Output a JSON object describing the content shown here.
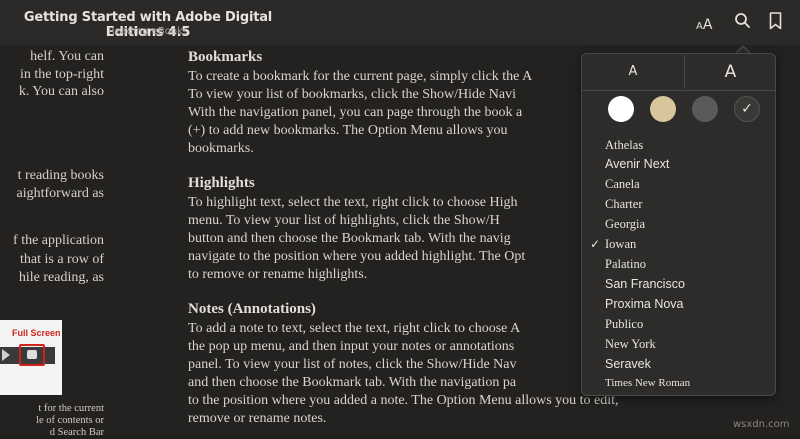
{
  "window": {
    "title": "Getting Started with Adobe Digital Editions 4.5",
    "subtitle": "Reading eBooks"
  },
  "toolbar": {
    "text_size_icon": "text-size-icon",
    "search_icon": "search-icon",
    "bookmark_icon": "bookmark-icon"
  },
  "left_column": {
    "lines": [
      "helf. You can",
      "in the top-right",
      "k. You can also",
      "t reading books",
      "aightforward as",
      "f the application",
      "that is a row of",
      "hile reading, as"
    ],
    "image_label": "Full Screen",
    "caption": [
      "t for the current",
      "le of contents or",
      "d  Search  Bar"
    ]
  },
  "content": {
    "sections": [
      {
        "heading": "Bookmarks",
        "lines": [
          "To create a bookmark for the current page, simply click the A",
          "To view your list of bookmarks, click the Show/Hide Navi",
          "With the navigation panel, you can page through the book a",
          "(+) to add new bookmarks. The Option Menu allows you",
          "bookmarks."
        ]
      },
      {
        "heading": "Highlights",
        "lines": [
          "To highlight text, select the text, right click to choose High",
          "menu. To view your list of highlights, click the Show/H",
          "button and then choose the Bookmark tab. With the navig",
          "navigate to the position where you added highlight. The Opt",
          "to remove or rename highlights."
        ]
      },
      {
        "heading": "Notes (Annotations)",
        "lines": [
          "To add a note to text, select the text, right click to choose A",
          "the pop up menu, and then input your notes or annotations",
          "panel. To view your list of notes, click the Show/Hide Nav",
          "and then choose the Bookmark tab. With the navigation pa",
          "to the position where you added a note. The Option Menu allows you to edit,",
          "remove or rename notes."
        ]
      }
    ]
  },
  "popup": {
    "smaller_label": "A",
    "larger_label": "A",
    "themes": [
      {
        "name": "white",
        "color": "#ffffff"
      },
      {
        "name": "sepia",
        "color": "#d8c59c"
      },
      {
        "name": "gray",
        "color": "#5b5a58"
      },
      {
        "name": "night",
        "color": "#3a3938",
        "selected": true
      }
    ],
    "theme_check": "✓",
    "fonts": [
      "Athelas",
      "Avenir Next",
      "Canela",
      "Charter",
      "Georgia",
      "Iowan",
      "Palatino",
      "San Francisco",
      "Proxima Nova",
      "Publico",
      "New York",
      "Seravek",
      "Times New Roman"
    ],
    "selected_font": "Iowan",
    "font_check": "✓"
  },
  "watermark": "wsxdn.com",
  "colors": {
    "background": "#1f1e1d",
    "titlebar": "#2b2a29",
    "popup": "#2d2c2b"
  }
}
